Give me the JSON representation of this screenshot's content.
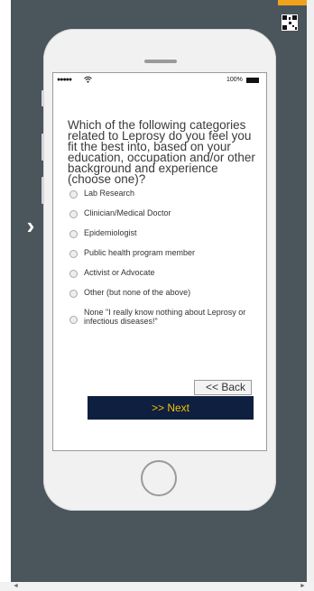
{
  "colors": {
    "stage_bg": "#4b555c",
    "phone_body": "#f1f1f1",
    "next_bg": "#0e1f40",
    "next_text": "#f2c100",
    "accent_top": "#f1a21b"
  },
  "icons": {
    "nav_next": "›",
    "qr": "qr-code-icon",
    "wifi": "wifi-icon",
    "battery": "battery-icon"
  },
  "statusbar": {
    "signal": "●●●●●",
    "battery_pct": "100%"
  },
  "survey": {
    "question": "Which of the following categories related to Leprosy do you feel you fit the best into, based on your education, occupation and/or other background and experience (choose one)?",
    "options": [
      "Lab Research",
      "Clinician/Medical Doctor",
      "Epidemiologist",
      "Public health program member",
      "Activist or Advocate",
      "Other (but none of the above)",
      "None \"I really know nothing about Leprosy or infectious diseases!\""
    ],
    "back_label": "<< Back",
    "next_label": ">> Next"
  },
  "scrollbar": {
    "left_arrow": "◄",
    "right_arrow": "►"
  }
}
